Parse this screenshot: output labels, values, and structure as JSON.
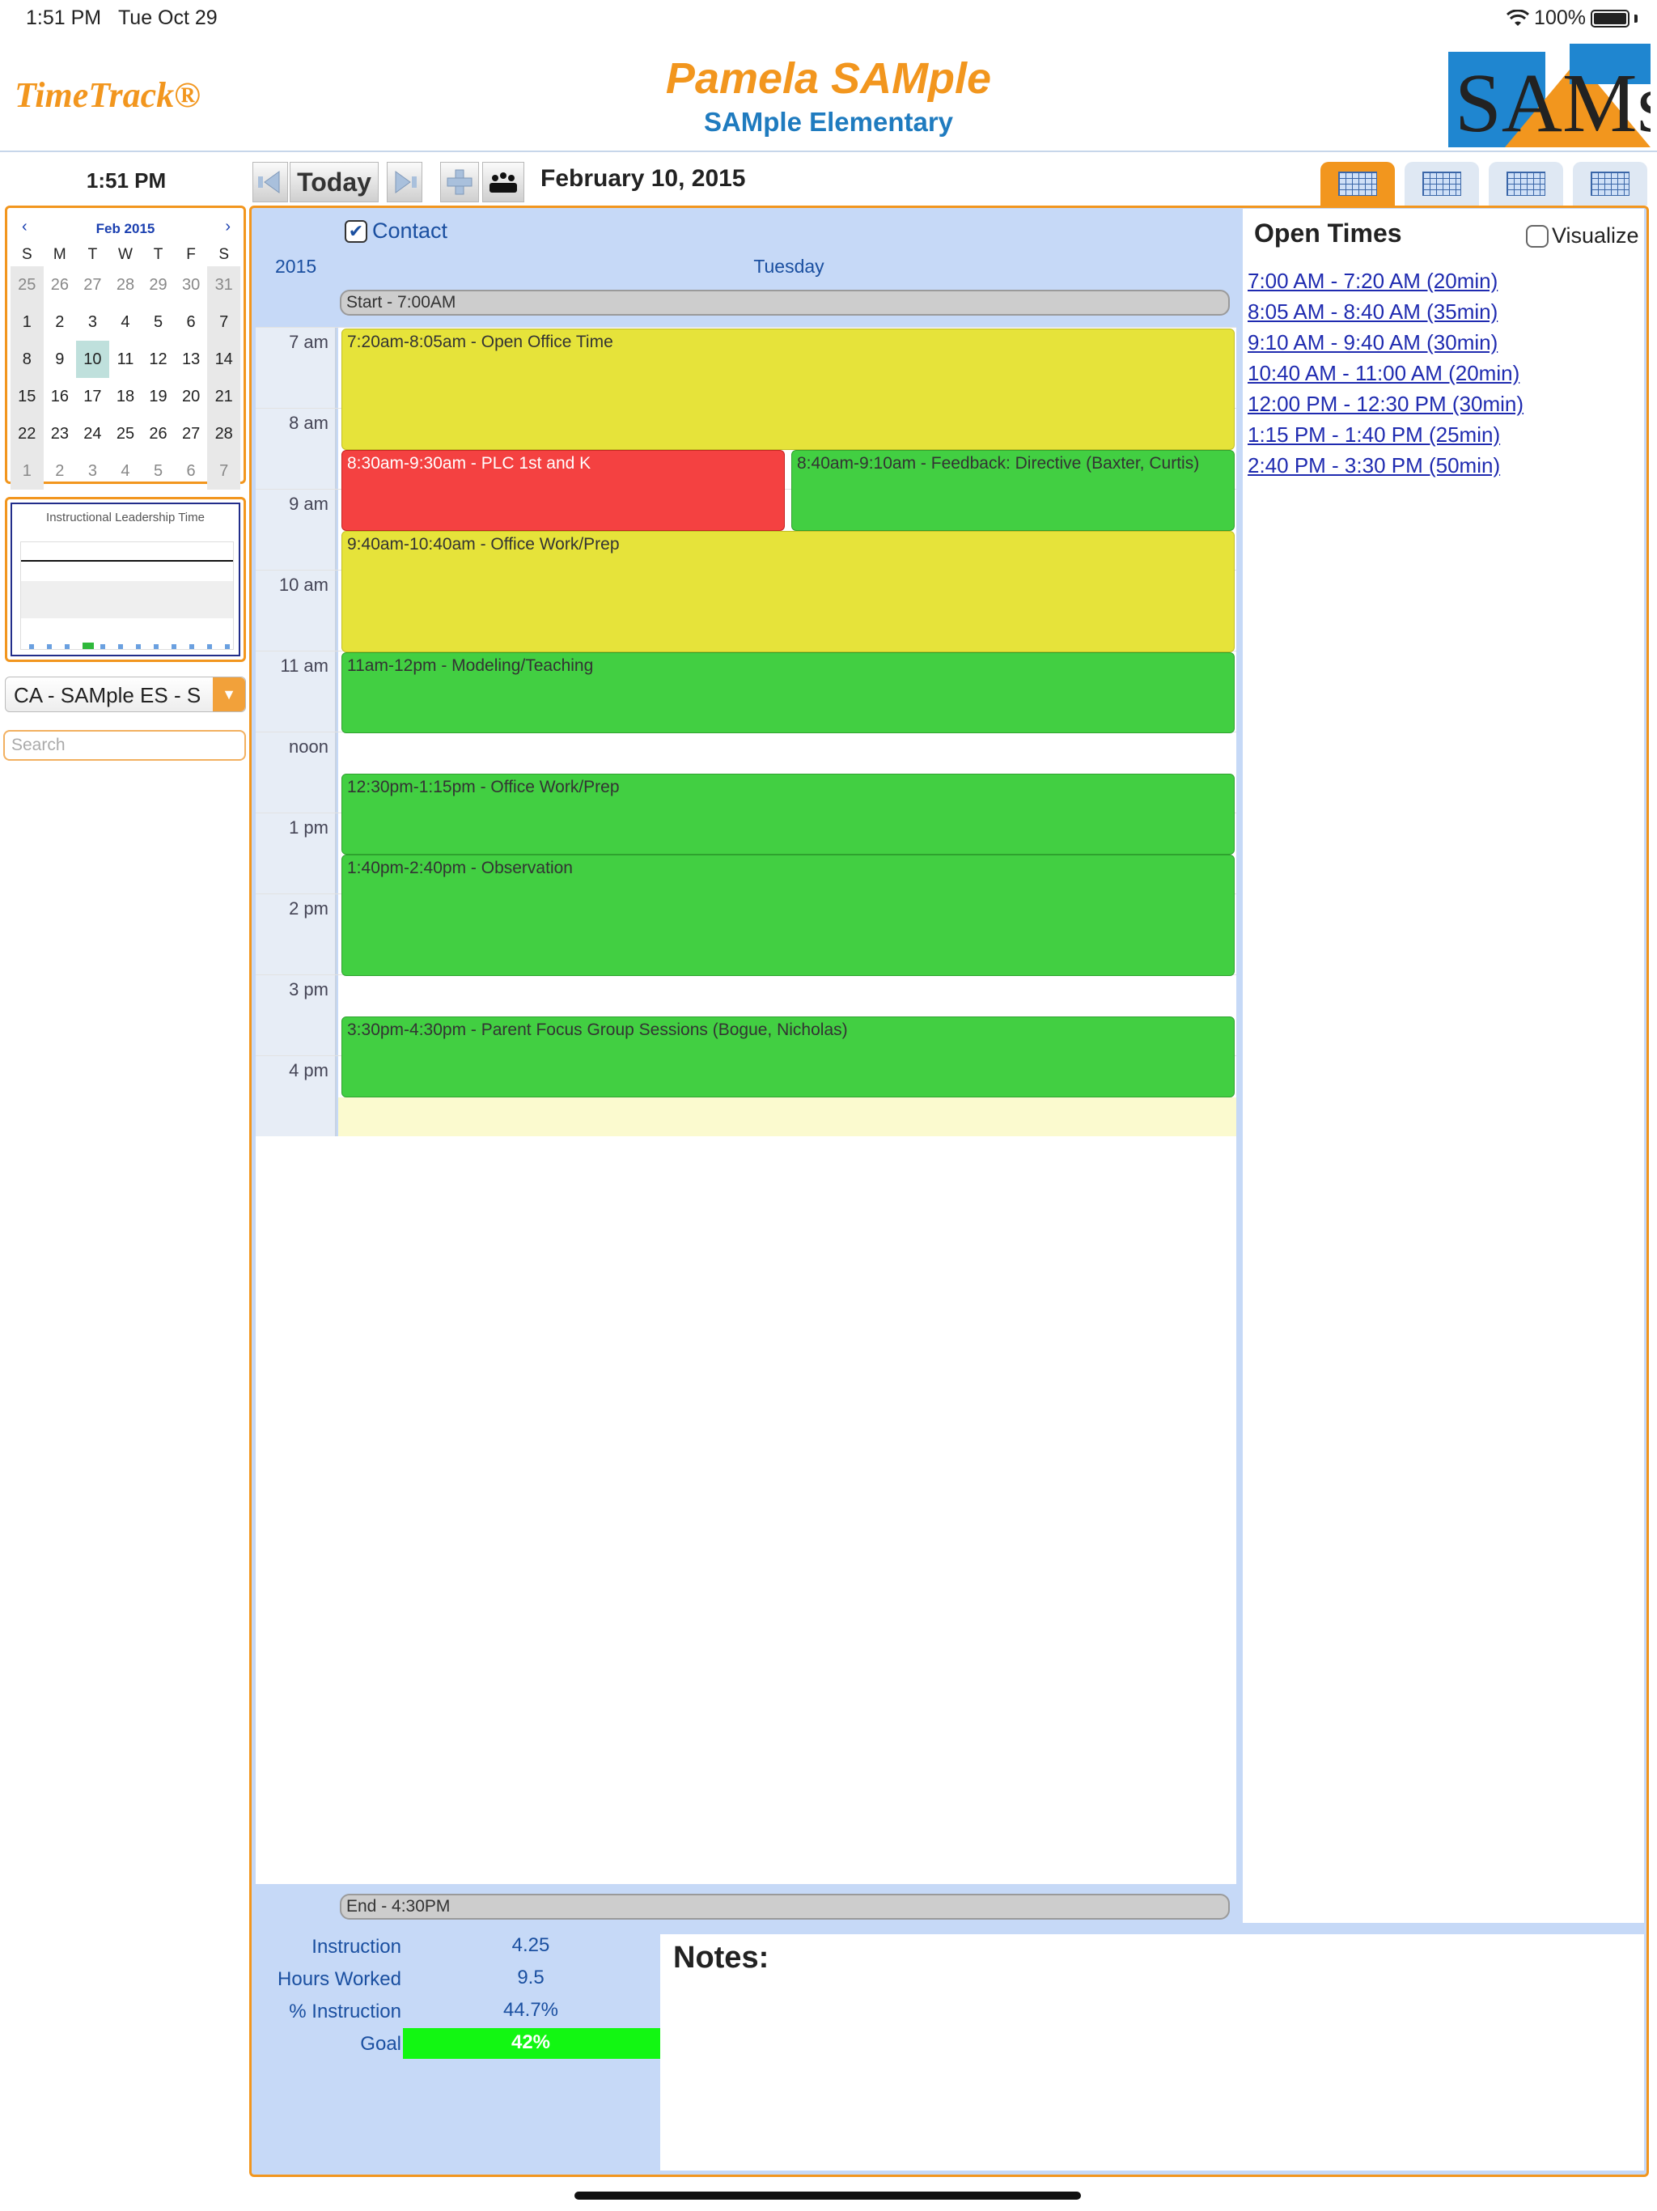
{
  "status_bar": {
    "time": "1:51 PM",
    "date": "Tue Oct 29",
    "battery": "100%"
  },
  "header": {
    "brand": "TimeTrack®",
    "user_name": "Pamela SAMple",
    "school": "SAMple Elementary",
    "logo_text": "SAMs"
  },
  "toolbar": {
    "clock": "1:51 PM",
    "today_label": "Today",
    "date_title": "February 10, 2015"
  },
  "mini_calendar": {
    "month": "Feb 2015",
    "prev": "‹",
    "next": "›",
    "weekdays": [
      "S",
      "M",
      "T",
      "W",
      "T",
      "F",
      "S"
    ],
    "weeks": [
      [
        "25",
        "26",
        "27",
        "28",
        "29",
        "30",
        "31"
      ],
      [
        "1",
        "2",
        "3",
        "4",
        "5",
        "6",
        "7"
      ],
      [
        "8",
        "9",
        "10",
        "11",
        "12",
        "13",
        "14"
      ],
      [
        "15",
        "16",
        "17",
        "18",
        "19",
        "20",
        "21"
      ],
      [
        "22",
        "23",
        "24",
        "25",
        "26",
        "27",
        "28"
      ],
      [
        "1",
        "2",
        "3",
        "4",
        "5",
        "6",
        "7"
      ]
    ],
    "selected": "10"
  },
  "ilt_chart": {
    "title": "Instructional Leadership Time"
  },
  "school_select": {
    "value": "CA - SAMple ES - S"
  },
  "search": {
    "placeholder": "Search"
  },
  "day_view": {
    "contact_label": "Contact",
    "contact_checked": "✔",
    "year": "2015",
    "day_name": "Tuesday",
    "start_label": "Start - 7:00AM",
    "end_label": "End - 4:30PM",
    "hours": [
      "7 am",
      "8 am",
      "9 am",
      "10 am",
      "11 am",
      "noon",
      "1 pm",
      "2 pm",
      "3 pm",
      "4 pm"
    ],
    "events": [
      {
        "label": "7:20am-8:05am - Open Office Time"
      },
      {
        "label": "8:30am-9:30am - PLC 1st and K"
      },
      {
        "label": "8:40am-9:10am - Feedback: Directive (Baxter, Curtis)"
      },
      {
        "label": "9:40am-10:40am - Office Work/Prep"
      },
      {
        "label": "11am-12pm - Modeling/Teaching"
      },
      {
        "label": "12:30pm-1:15pm - Office Work/Prep"
      },
      {
        "label": "1:40pm-2:40pm - Observation"
      },
      {
        "label": "3:30pm-4:30pm - Parent Focus Group Sessions (Bogue, Nicholas)"
      }
    ],
    "colors": {
      "yellow": "#e6e33a",
      "green": "#42cf42",
      "red": "#f44141"
    }
  },
  "open_times": {
    "title": "Open Times",
    "visualize_label": "Visualize",
    "slots": [
      "7:00 AM - 7:20 AM (20min)",
      "8:05 AM - 8:40 AM (35min)",
      "9:10 AM - 9:40 AM (30min)",
      "10:40 AM - 11:00 AM (20min)",
      "12:00 PM - 12:30 PM (30min)",
      "1:15 PM - 1:40 PM (25min)",
      "2:40 PM - 3:30 PM (50min)"
    ]
  },
  "stats": {
    "instruction_label": "Instruction",
    "instruction_value": "4.25",
    "hours_label": "Hours Worked",
    "hours_value": "9.5",
    "pct_label": "% Instruction",
    "pct_value": "44.7%",
    "goal_label": "Goal",
    "goal_value": "42%"
  },
  "notes": {
    "title": "Notes:"
  },
  "theme": {
    "accent": "#f2961e",
    "link": "#1f2bb0",
    "panel": "#c6d9f7",
    "goal": "#12f712"
  }
}
